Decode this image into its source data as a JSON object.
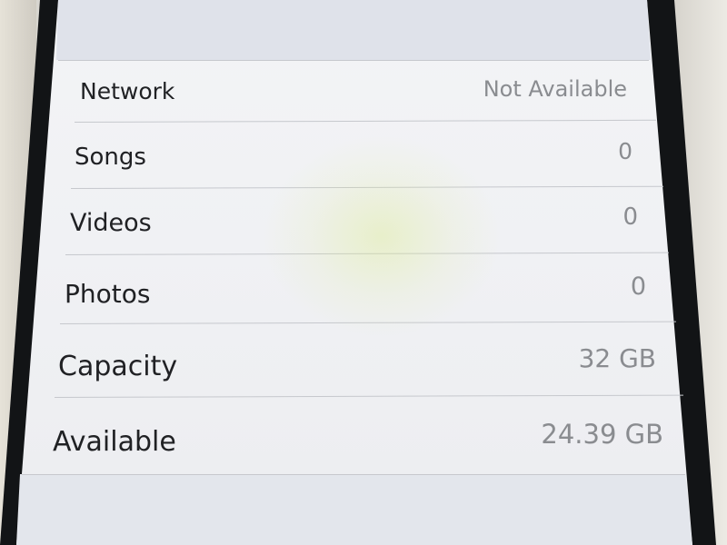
{
  "settings_list": {
    "rows": [
      {
        "label": "Network",
        "value": "Not Available"
      },
      {
        "label": "Songs",
        "value": "0"
      },
      {
        "label": "Videos",
        "value": "0"
      },
      {
        "label": "Photos",
        "value": "0"
      },
      {
        "label": "Capacity",
        "value": "32 GB"
      },
      {
        "label": "Available",
        "value": "24.39 GB"
      }
    ]
  }
}
